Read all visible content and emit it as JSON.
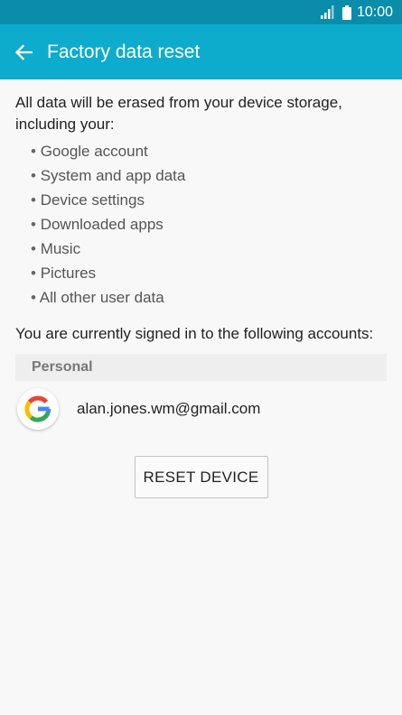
{
  "status_bar": {
    "time": "10:00"
  },
  "app_bar": {
    "title": "Factory data reset",
    "back_icon": "arrow-left-icon"
  },
  "intro": "All data will be erased from your device storage, including your:",
  "items": [
    "Google account",
    "System and app data",
    "Device settings",
    "Downloaded apps",
    "Music",
    "Pictures",
    "All other user data"
  ],
  "signed_in_text": "You are currently signed in to the following accounts:",
  "accounts": {
    "section_label": "Personal",
    "entries": [
      {
        "icon": "google-icon",
        "email": "alan.jones.wm@gmail.com"
      }
    ]
  },
  "reset_button": {
    "label": "RESET DEVICE"
  },
  "colors": {
    "status_bar": "#0a8dab",
    "app_bar": "#0eaccc",
    "background": "#f8f8f8"
  }
}
